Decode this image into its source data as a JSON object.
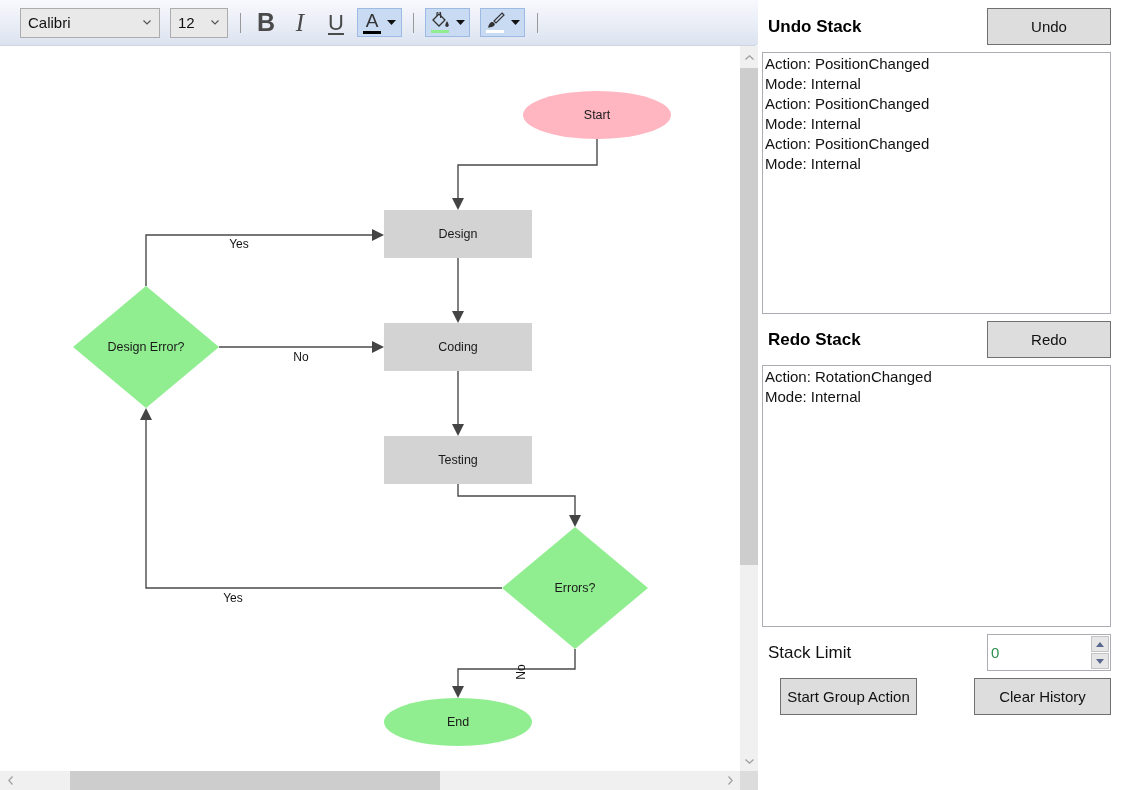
{
  "toolbar": {
    "font_family": {
      "value": "Calibri"
    },
    "font_size": {
      "value": "12"
    },
    "buttons": [
      {
        "kind": "bold",
        "label": "B",
        "selected": false
      },
      {
        "kind": "italic",
        "label": "I",
        "selected": false
      },
      {
        "kind": "underline",
        "label": "U",
        "selected": false
      },
      {
        "kind": "font-color",
        "label": "A",
        "selected": true,
        "color": "#000000"
      },
      {
        "kind": "fill-color",
        "selected": true,
        "color": "#90ee90"
      },
      {
        "kind": "stroke-color",
        "selected": true,
        "color": "#ffffff"
      }
    ]
  },
  "diagram": {
    "nodes": [
      {
        "kind": "terminator",
        "label": "Start",
        "color": "#ffb6c1"
      },
      {
        "kind": "process",
        "label": "Design",
        "color": "#d3d3d3"
      },
      {
        "kind": "decision",
        "label": "Design Error?",
        "color": "#90ee90"
      },
      {
        "kind": "process",
        "label": "Coding",
        "color": "#d3d3d3"
      },
      {
        "kind": "process",
        "label": "Testing",
        "color": "#d3d3d3"
      },
      {
        "kind": "decision",
        "label": "Errors?",
        "color": "#90ee90"
      },
      {
        "kind": "terminator",
        "label": "End",
        "color": "#90ee90"
      }
    ],
    "connector_labels": [
      "Yes",
      "No",
      "Yes",
      "No"
    ]
  },
  "undo_stack": {
    "title": "Undo Stack",
    "button": "Undo",
    "entries": [
      "Action: PositionChanged",
      "Mode: Internal",
      "Action: PositionChanged",
      "Mode: Internal",
      "Action: PositionChanged",
      "Mode: Internal"
    ]
  },
  "redo_stack": {
    "title": "Redo Stack",
    "button": "Redo",
    "entries": [
      "Action: RotationChanged",
      "Mode: Internal"
    ]
  },
  "stack_limit": {
    "label": "Stack Limit",
    "value": "0"
  },
  "buttons": [
    "Start Group Action",
    "Clear History"
  ]
}
